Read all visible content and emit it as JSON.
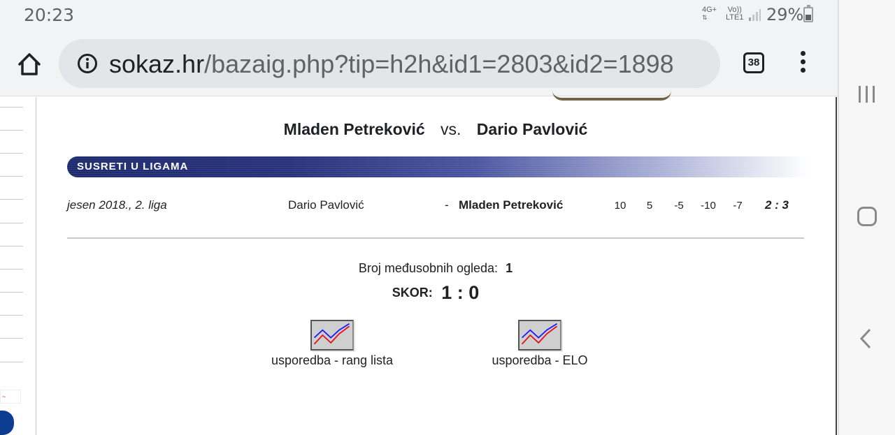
{
  "status_bar": {
    "time": "20:23",
    "network": "4G+",
    "volte_top": "Vo))",
    "volte_bottom": "LTE1",
    "battery": "29%"
  },
  "browser": {
    "url_domain": "sokaz.hr",
    "url_path": "/bazaig.php?tip=h2h&id1=2803&id2=1898",
    "tab_count": "38"
  },
  "page": {
    "player1": "Mladen Petreković",
    "vs": "vs.",
    "player2": "Dario Pavlović",
    "section_title": "SUSRETI U LIGAMA",
    "match": {
      "season": "jesen 2018., 2. liga",
      "home": "Dario Pavlović",
      "dash": "-",
      "away": "Mladen Petreković",
      "sets": [
        "10",
        "5",
        "-5",
        "-10",
        "-7"
      ],
      "result": "2 : 3"
    },
    "meetings_label": "Broj međusobnih ogleda:",
    "meetings_count": "1",
    "score_label": "SKOR:",
    "score_value": "1 : 0",
    "links": {
      "rank": "usporedba - rang lista",
      "elo": "usporedba - ELO"
    }
  },
  "colors": {
    "section_bar": "#1e2a6e",
    "chart_line_blue": "#1a1aff",
    "chart_line_red": "#e0141e"
  }
}
